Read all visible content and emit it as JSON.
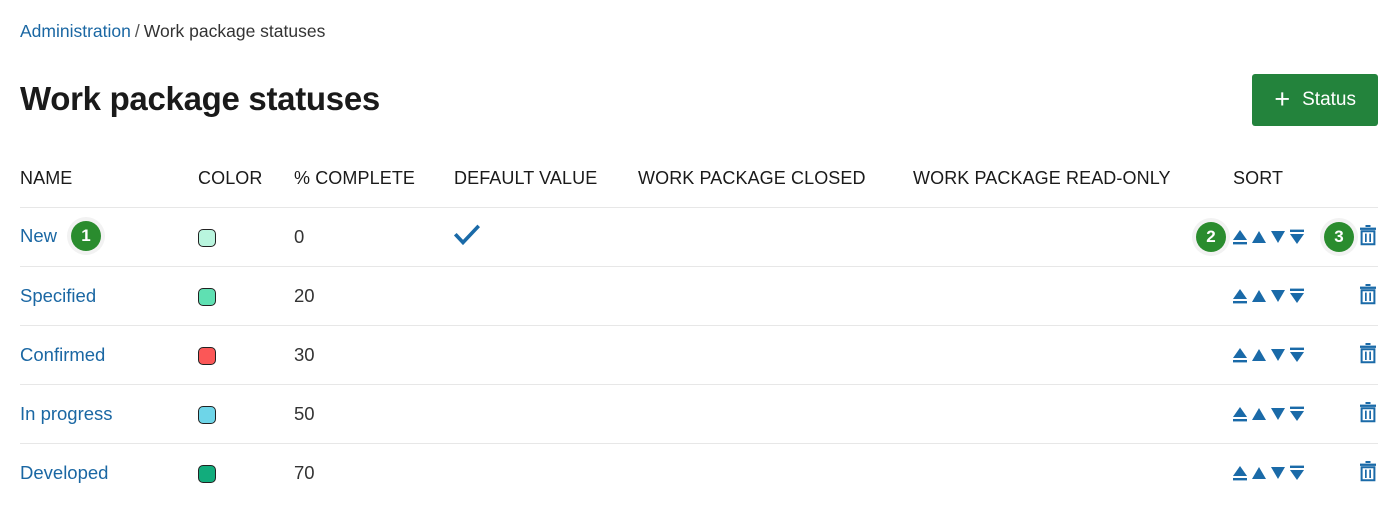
{
  "breadcrumb": {
    "root_label": "Administration",
    "separator": "/",
    "current_label": "Work package statuses"
  },
  "header": {
    "title": "Work package statuses",
    "add_button": {
      "plus": "+",
      "label": "Status"
    }
  },
  "table": {
    "columns": [
      "NAME",
      "COLOR",
      "% COMPLETE",
      "DEFAULT VALUE",
      "WORK PACKAGE CLOSED",
      "WORK PACKAGE READ-ONLY",
      "SORT"
    ],
    "rows": [
      {
        "name": "New",
        "color": "#b9f5de",
        "percent_complete": "0",
        "default_value": "✔",
        "work_package_closed": "",
        "work_package_read_only": ""
      },
      {
        "name": "Specified",
        "color": "#5fe0b2",
        "percent_complete": "20",
        "default_value": "",
        "work_package_closed": "",
        "work_package_read_only": ""
      },
      {
        "name": "Confirmed",
        "color": "#fb5757",
        "percent_complete": "30",
        "default_value": "",
        "work_package_closed": "",
        "work_package_read_only": ""
      },
      {
        "name": "In progress",
        "color": "#6ed5e8",
        "percent_complete": "50",
        "default_value": "",
        "work_package_closed": "",
        "work_package_read_only": ""
      },
      {
        "name": "Developed",
        "color": "#12ac7c",
        "percent_complete": "70",
        "default_value": "",
        "work_package_closed": "",
        "work_package_read_only": ""
      }
    ],
    "sort_actions": [
      "move-to-top",
      "move-up",
      "move-down",
      "move-to-bottom"
    ],
    "delete_action": "delete-status"
  },
  "annotations": [
    {
      "number": "1",
      "target": "status-name-link"
    },
    {
      "number": "2",
      "target": "sort-controls"
    },
    {
      "number": "3",
      "target": "delete-button"
    }
  ],
  "colors": {
    "accent_green": "#23833c",
    "badge_green": "#2a8c2e",
    "link_blue": "#1a67a3",
    "icon_blue": "#1a6aa8"
  }
}
